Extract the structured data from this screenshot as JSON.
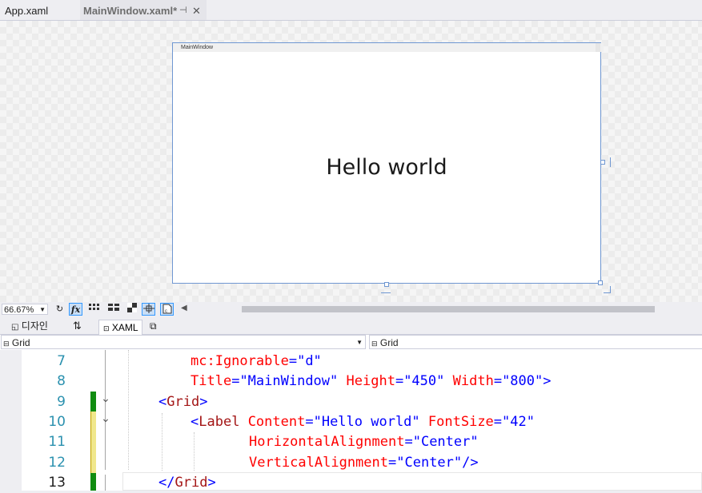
{
  "tabs": [
    {
      "label": "App.xaml"
    },
    {
      "label": "MainWindow.xaml*",
      "pin": "⊣",
      "close": "✕"
    }
  ],
  "designer": {
    "window_title": "MainWindow",
    "label_text": "Hello world"
  },
  "toolbar": {
    "zoom": "66.67%",
    "icons": [
      "refresh-icon",
      "fx-icon",
      "grid-icon",
      "snap-grid-icon",
      "artboard-icon",
      "snap-lines-icon",
      "project-code-icon"
    ]
  },
  "split_tabs": {
    "design_label": "디자인",
    "swap_label": "⇅",
    "xaml_label": "XAML"
  },
  "navigation": {
    "left_combo": "Grid",
    "right_combo": "Grid"
  },
  "code_lines": [
    {
      "num": "7",
      "text": "mc:Ignorable=\"d\""
    },
    {
      "num": "8",
      "text": "Title=\"MainWindow\" Height=\"450\" Width=\"800\">"
    },
    {
      "num": "9",
      "text": "<Grid>"
    },
    {
      "num": "10",
      "text": "<Label Content=\"Hello world\" FontSize=\"42\""
    },
    {
      "num": "11",
      "text": "HorizontalAlignment=\"Center\""
    },
    {
      "num": "12",
      "text": "VerticalAlignment=\"Center\"/>"
    },
    {
      "num": "13",
      "text": "</Grid>"
    }
  ],
  "colors": {
    "line_number": "#2b91af",
    "xml_tag": "#a31515",
    "xml_attribute": "#ff0000",
    "xml_value": "#0000ff",
    "change_saved": "#108c10",
    "change_unsaved": "#f0e78c",
    "selection_border": "#6f97d2"
  }
}
